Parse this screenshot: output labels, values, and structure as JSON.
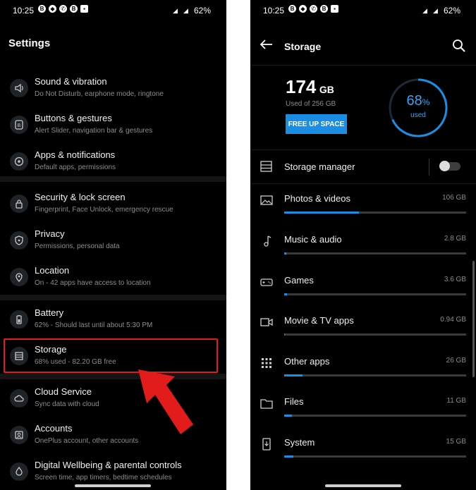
{
  "status": {
    "time": "10:25",
    "battery": "62%",
    "network": "4G"
  },
  "left": {
    "title": "Settings",
    "items": [
      {
        "title": "Sound & vibration",
        "subtitle": "Do Not Disturb, earphone mode, ringtone",
        "icon": "speaker-icon"
      },
      {
        "title": "Buttons & gestures",
        "subtitle": "Alert Slider, navigation bar & gestures",
        "icon": "button-icon"
      },
      {
        "title": "Apps & notifications",
        "subtitle": "Default apps, permissions",
        "icon": "apps-icon"
      },
      {
        "title": "Security & lock screen",
        "subtitle": "Fingerprint, Face Unlock, emergency rescue",
        "icon": "lock-icon"
      },
      {
        "title": "Privacy",
        "subtitle": "Permissions, personal data",
        "icon": "shield-icon"
      },
      {
        "title": "Location",
        "subtitle": "On - 42 apps have access to location",
        "icon": "location-pin-icon"
      },
      {
        "title": "Battery",
        "subtitle": "62% - Should last until about 5:30 PM",
        "icon": "battery-icon"
      },
      {
        "title": "Storage",
        "subtitle": "68% used - 82.20 GB free",
        "icon": "storage-icon"
      },
      {
        "title": "Cloud Service",
        "subtitle": "Sync data with cloud",
        "icon": "cloud-icon"
      },
      {
        "title": "Accounts",
        "subtitle": "OnePlus account, other accounts",
        "icon": "account-icon"
      },
      {
        "title": "Digital Wellbeing & parental controls",
        "subtitle": "Screen time, app timers, bedtime schedules",
        "icon": "wellbeing-icon"
      }
    ],
    "highlight_color": "#e21b1b"
  },
  "right": {
    "title": "Storage",
    "used_value": "174",
    "used_unit": "GB",
    "used_of": "Used of 256 GB",
    "free_up_label": "FREE UP SPACE",
    "ring_percent_num": "68",
    "ring_percent_sign": "%",
    "ring_percent": 68,
    "ring_used_label": "used",
    "manager_label": "Storage manager",
    "manager_enabled": false,
    "accent": "#1a8ee5",
    "categories": [
      {
        "name": "Photos & videos",
        "size": "106 GB",
        "fraction": 0.41,
        "icon": "image-icon"
      },
      {
        "name": "Music & audio",
        "size": "2.8 GB",
        "fraction": 0.012,
        "icon": "music-note-icon"
      },
      {
        "name": "Games",
        "size": "3.6 GB",
        "fraction": 0.015,
        "icon": "gamepad-icon"
      },
      {
        "name": "Movie & TV apps",
        "size": "0.94 GB",
        "fraction": 0.005,
        "icon": "video-camera-icon"
      },
      {
        "name": "Other apps",
        "size": "26 GB",
        "fraction": 0.1,
        "icon": "grid-icon"
      },
      {
        "name": "Files",
        "size": "11 GB",
        "fraction": 0.043,
        "icon": "folder-icon"
      },
      {
        "name": "System",
        "size": "15 GB",
        "fraction": 0.05,
        "icon": "phone-download-icon"
      }
    ]
  }
}
